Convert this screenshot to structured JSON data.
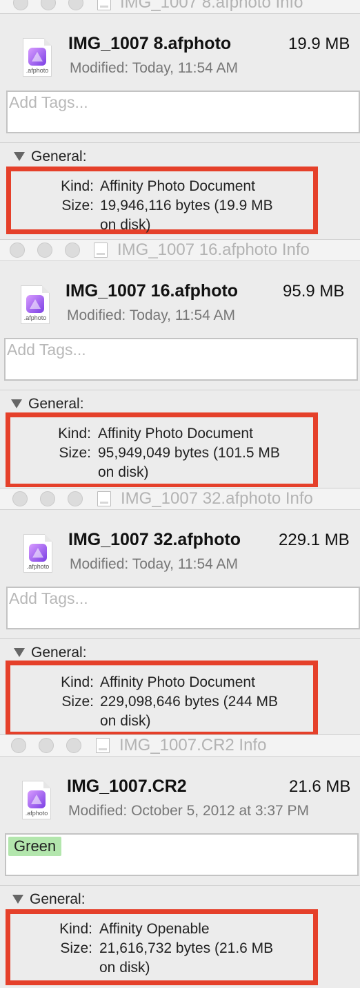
{
  "windows": [
    {
      "title": "IMG_1007 8.afphoto Info",
      "file_name": "IMG_1007 8.afphoto",
      "size": "19.9 MB",
      "modified_label": "Modified:",
      "modified_value": "Today, 11:54 AM",
      "icon_ext": ".afphoto",
      "tags_placeholder": "Add Tags...",
      "section": "General:",
      "kind_label": "Kind:",
      "kind_value": "Affinity Photo Document",
      "size_label": "Size:",
      "size_value_line1": "19,946,116 bytes (19.9 MB",
      "size_value_line2": "on disk)"
    },
    {
      "title": "IMG_1007 16.afphoto Info",
      "file_name": "IMG_1007 16.afphoto",
      "size": "95.9 MB",
      "modified_label": "Modified:",
      "modified_value": "Today, 11:54 AM",
      "icon_ext": ".afphoto",
      "tags_placeholder": "Add Tags...",
      "section": "General:",
      "kind_label": "Kind:",
      "kind_value": "Affinity Photo Document",
      "size_label": "Size:",
      "size_value_line1": "95,949,049 bytes (101.5 MB",
      "size_value_line2": "on disk)"
    },
    {
      "title": "IMG_1007 32.afphoto Info",
      "file_name": "IMG_1007 32.afphoto",
      "size": "229.1 MB",
      "modified_label": "Modified:",
      "modified_value": "Today, 11:54 AM",
      "icon_ext": ".afphoto",
      "tags_placeholder": "Add Tags...",
      "section": "General:",
      "kind_label": "Kind:",
      "kind_value": "Affinity Photo Document",
      "size_label": "Size:",
      "size_value_line1": "229,098,646 bytes (244 MB",
      "size_value_line2": "on disk)"
    },
    {
      "title": "IMG_1007.CR2 Info",
      "file_name": "IMG_1007.CR2",
      "size": "21.6 MB",
      "modified_label": "Modified:",
      "modified_value": "October 5, 2012 at 3:37 PM",
      "icon_ext": ".afphoto",
      "tag": "Green",
      "section": "General:",
      "kind_label": "Kind:",
      "kind_value": "Affinity Openable",
      "size_label": "Size:",
      "size_value_line1": "21,616,732 bytes (21.6 MB",
      "size_value_line2": "on disk)"
    }
  ],
  "colors": {
    "highlight": "#e5402a",
    "tag_green": "#b3e6ad",
    "window_bg": "#ececec"
  }
}
